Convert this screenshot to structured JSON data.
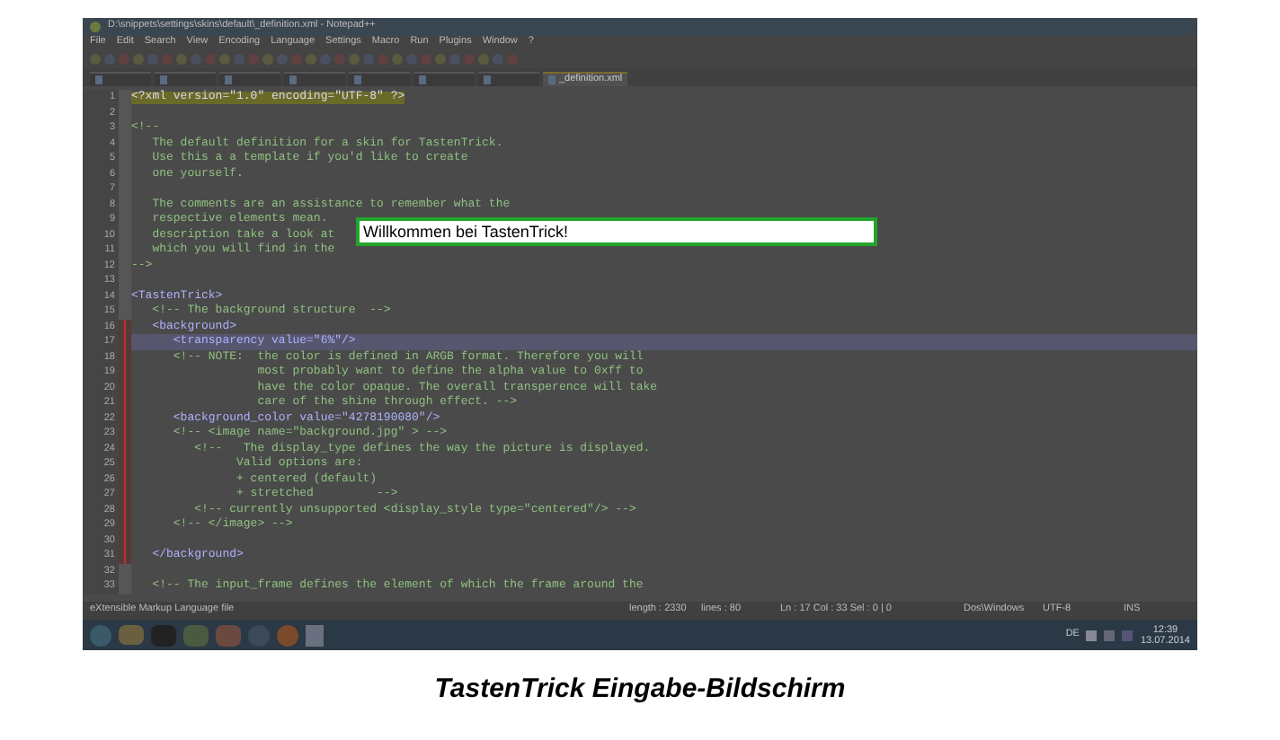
{
  "window": {
    "title": "D:\\snippets\\settings\\skins\\default\\_definition.xml - Notepad++"
  },
  "menu": [
    "File",
    "Edit",
    "Search",
    "View",
    "Encoding",
    "Language",
    "Settings",
    "Macro",
    "Run",
    "Plugins",
    "Window",
    "?"
  ],
  "tabs": [
    {
      "selected": false
    },
    {
      "selected": false
    },
    {
      "selected": false
    },
    {
      "selected": false
    },
    {
      "selected": false
    },
    {
      "selected": false
    },
    {
      "selected": false
    },
    {
      "label": "_definition.xml",
      "selected": true
    }
  ],
  "lines": [
    {
      "number": "1",
      "kind": "decl",
      "text": "<?xml version=\"1.0\" encoding=\"UTF-8\" ?>",
      "modified": false,
      "highlighted": false
    },
    {
      "number": "2",
      "modified": false,
      "highlighted": false
    },
    {
      "number": "3",
      "kind": "comment",
      "text": "<!--",
      "modified": false,
      "highlighted": false
    },
    {
      "number": "4",
      "kind": "comment",
      "text": "   The default definition for a skin for TastenTrick.",
      "modified": false,
      "highlighted": false
    },
    {
      "number": "5",
      "kind": "comment",
      "text": "   Use this a a template if you'd like to create",
      "modified": false,
      "highlighted": false
    },
    {
      "number": "6",
      "kind": "comment",
      "text": "   one yourself.",
      "modified": false,
      "highlighted": false
    },
    {
      "number": "7",
      "modified": false,
      "highlighted": false
    },
    {
      "number": "8",
      "kind": "comment",
      "text": "   The comments are an assistance to remember what the",
      "modified": false,
      "highlighted": false
    },
    {
      "number": "9",
      "kind": "comment",
      "text": "   respective elements mean.",
      "modified": false,
      "highlighted": false
    },
    {
      "number": "10",
      "kind": "comment",
      "text": "   description take a look at",
      "modified": false,
      "highlighted": false
    },
    {
      "number": "11",
      "kind": "comment",
      "text": "   which you will find in the",
      "modified": false,
      "highlighted": false
    },
    {
      "number": "12",
      "kind": "comment",
      "text": "-->",
      "modified": false,
      "highlighted": false
    },
    {
      "number": "13",
      "modified": false,
      "highlighted": false
    },
    {
      "number": "14",
      "kind": "tag",
      "text": "<TastenTrick>",
      "modified": false,
      "highlighted": false
    },
    {
      "number": "15",
      "kind": "comment",
      "text": "   <!-- The background structure  -->",
      "modified": false,
      "highlighted": false
    },
    {
      "number": "16",
      "kind": "tag",
      "text": "   <background>",
      "modified": true,
      "highlighted": false
    },
    {
      "number": "17",
      "kind": "tag",
      "text": "      <transparency value=\"6%\"/>",
      "modified": true,
      "highlighted": true
    },
    {
      "number": "18",
      "kind": "comment",
      "text": "      <!-- NOTE:  the color is defined in ARGB format. Therefore you will",
      "modified": true,
      "highlighted": false
    },
    {
      "number": "19",
      "kind": "comment",
      "text": "                  most probably want to define the alpha value to 0xff to",
      "modified": true,
      "highlighted": false
    },
    {
      "number": "20",
      "kind": "comment",
      "text": "                  have the color opaque. The overall transperence will take",
      "modified": true,
      "highlighted": false
    },
    {
      "number": "21",
      "kind": "comment",
      "text": "                  care of the shine through effect. -->",
      "modified": true,
      "highlighted": false
    },
    {
      "number": "22",
      "kind": "tag",
      "text": "      <background_color value=\"4278190080\"/>",
      "modified": true,
      "highlighted": false
    },
    {
      "number": "23",
      "kind": "comment",
      "text": "      <!-- <image name=\"background.jpg\" > -->",
      "modified": true,
      "highlighted": false
    },
    {
      "number": "24",
      "kind": "comment",
      "text": "         <!--   The display_type defines the way the picture is displayed.",
      "modified": true,
      "highlighted": false
    },
    {
      "number": "25",
      "kind": "comment",
      "text": "               Valid options are:",
      "modified": true,
      "highlighted": false
    },
    {
      "number": "26",
      "kind": "comment",
      "text": "               + centered (default)",
      "modified": true,
      "highlighted": false
    },
    {
      "number": "27",
      "kind": "comment",
      "text": "               + stretched         -->",
      "modified": true,
      "highlighted": false
    },
    {
      "number": "28",
      "kind": "comment",
      "text": "         <!-- currently unsupported <display_style type=\"centered\"/> -->",
      "modified": true,
      "highlighted": false
    },
    {
      "number": "29",
      "kind": "comment",
      "text": "      <!-- </image> -->",
      "modified": true,
      "highlighted": false
    },
    {
      "number": "30",
      "modified": true,
      "highlighted": false
    },
    {
      "number": "31",
      "kind": "tag",
      "text": "   </background>",
      "modified": true,
      "highlighted": false
    },
    {
      "number": "32",
      "modified": false,
      "highlighted": false
    },
    {
      "number": "33",
      "kind": "comment",
      "text": "   <!-- The input_frame defines the element of which the frame around the",
      "modified": false,
      "highlighted": false
    }
  ],
  "input": {
    "value": "Willkommen bei TastenTrick!"
  },
  "status_bar": {
    "file_type": "eXtensible Markup Language file",
    "length": "length : 2330",
    "lines": "lines : 80",
    "position": "Ln : 17   Col : 33   Sel : 0 | 0",
    "eol": "Dos\\Windows",
    "encoding": "UTF-8",
    "mode": "INS"
  },
  "taskbar": {
    "language": "DE",
    "time": "12:39",
    "date": "13.07.2014"
  },
  "caption": "TastenTrick Eingabe-Bildschirm"
}
